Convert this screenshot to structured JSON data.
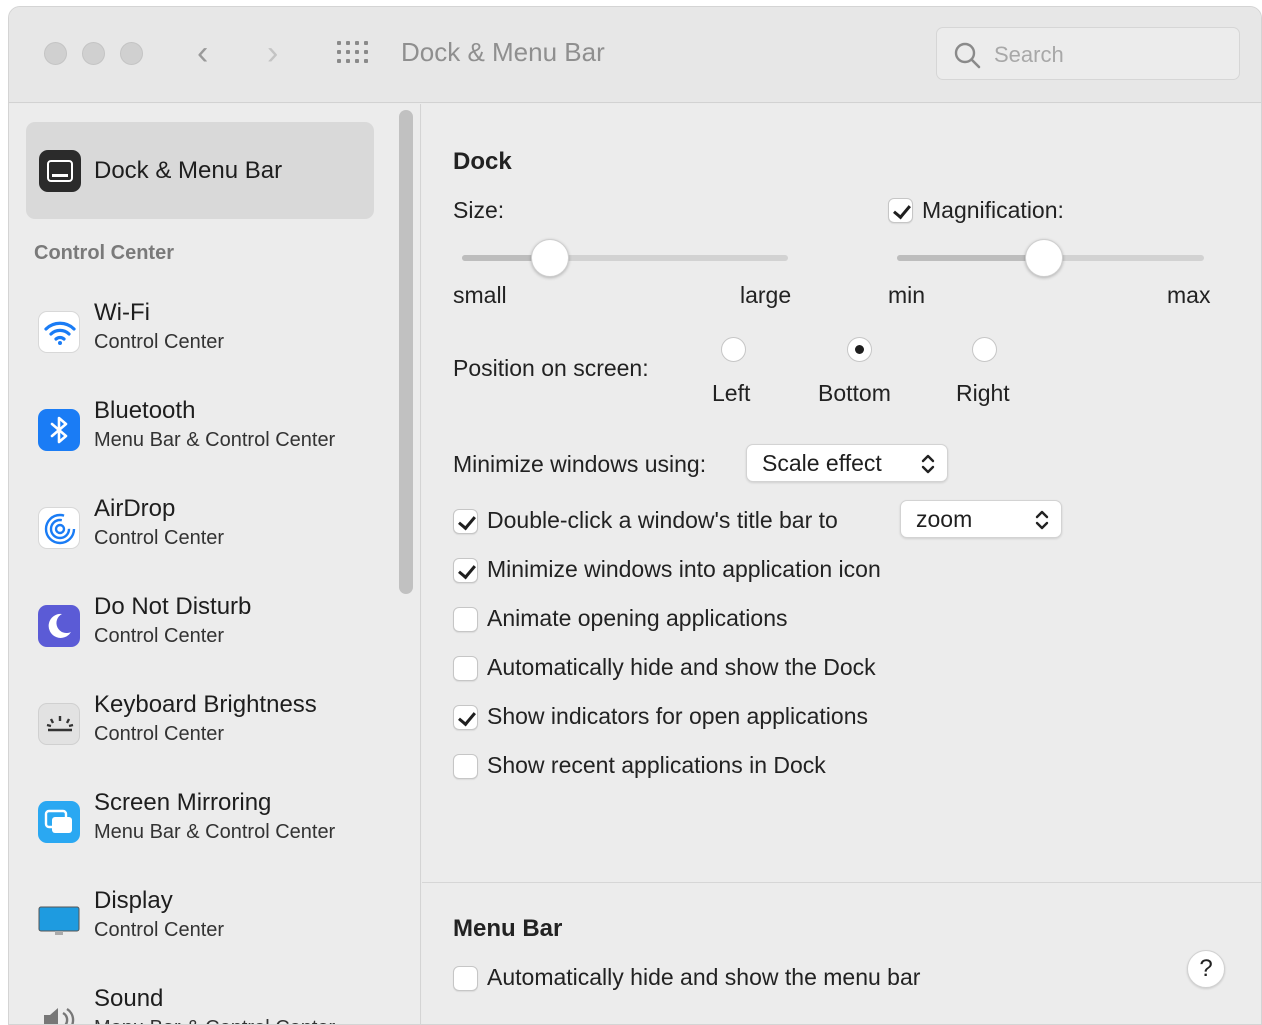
{
  "window": {
    "title": "Dock & Menu Bar"
  },
  "search": {
    "placeholder": "Search"
  },
  "sidebar": {
    "selected": {
      "label": "Dock & Menu Bar"
    },
    "section_header": "Control Center",
    "items": [
      {
        "name": "Wi-Fi",
        "sub": "Control Center",
        "icon": "wifi-icon",
        "color": "#ffffff"
      },
      {
        "name": "Bluetooth",
        "sub": "Menu Bar & Control Center",
        "icon": "bluetooth-icon",
        "color": "#1a7cf5"
      },
      {
        "name": "AirDrop",
        "sub": "Control Center",
        "icon": "airdrop-icon",
        "color": "#ffffff"
      },
      {
        "name": "Do Not Disturb",
        "sub": "Control Center",
        "icon": "moon-icon",
        "color": "#5b5bd6"
      },
      {
        "name": "Keyboard Brightness",
        "sub": "Control Center",
        "icon": "keyboard-brightness-icon",
        "color": "#e0e0e0"
      },
      {
        "name": "Screen Mirroring",
        "sub": "Menu Bar & Control Center",
        "icon": "screen-mirroring-icon",
        "color": "#2aa8f2"
      },
      {
        "name": "Display",
        "sub": "Control Center",
        "icon": "display-icon",
        "color": "#1e9be0"
      },
      {
        "name": "Sound",
        "sub": "Menu Bar & Control Center",
        "icon": "speaker-icon",
        "color": "#9a9a9a"
      }
    ]
  },
  "dock": {
    "heading": "Dock",
    "size_label": "Size:",
    "size_min_label": "small",
    "size_max_label": "large",
    "size_value": 0.27,
    "magnification_label": "Magnification:",
    "magnification_checked": true,
    "mag_min_label": "min",
    "mag_max_label": "max",
    "mag_value": 0.48,
    "position_label": "Position on screen:",
    "positions": [
      "Left",
      "Bottom",
      "Right"
    ],
    "position_selected": "Bottom",
    "minimize_label": "Minimize windows using:",
    "minimize_value": "Scale effect",
    "double_click_label": "Double-click a window's title bar to",
    "double_click_value": "zoom",
    "double_click_checked": true,
    "options": [
      {
        "label": "Minimize windows into application icon",
        "checked": true
      },
      {
        "label": "Animate opening applications",
        "checked": false
      },
      {
        "label": "Automatically hide and show the Dock",
        "checked": false
      },
      {
        "label": "Show indicators for open applications",
        "checked": true
      },
      {
        "label": "Show recent applications in Dock",
        "checked": false
      }
    ]
  },
  "menubar": {
    "heading": "Menu Bar",
    "autohide_label": "Automatically hide and show the menu bar",
    "autohide_checked": false
  },
  "help": {
    "label": "?"
  }
}
